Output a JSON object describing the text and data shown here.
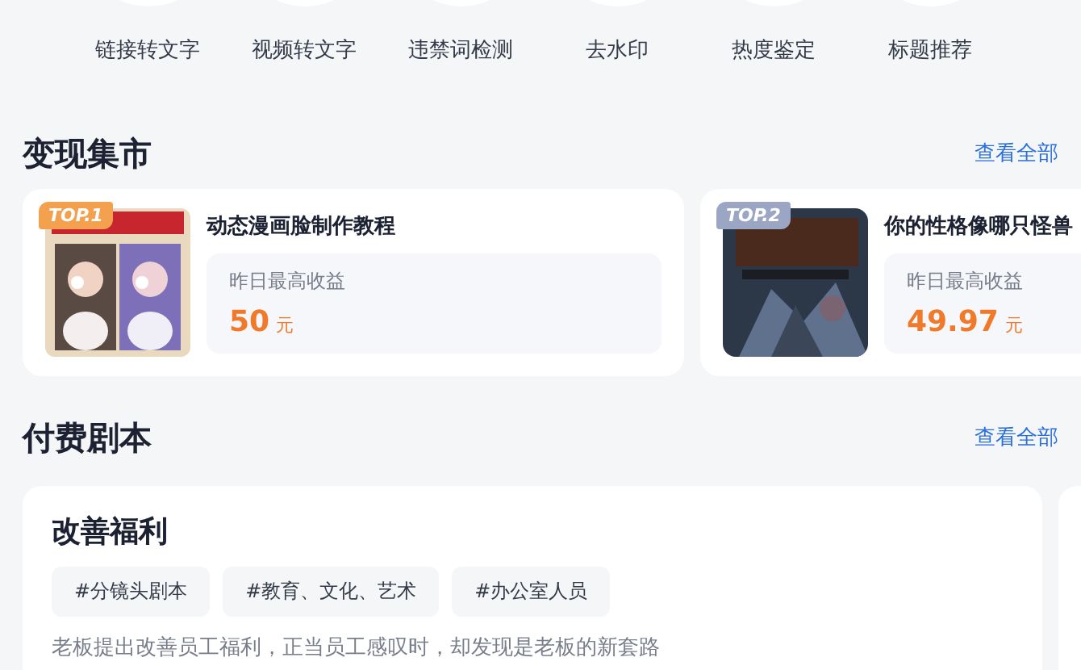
{
  "tools": [
    {
      "label": "链接转文字"
    },
    {
      "label": "视频转文字"
    },
    {
      "label": "违禁词检测"
    },
    {
      "label": "去水印"
    },
    {
      "label": "热度鉴定"
    },
    {
      "label": "标题推荐"
    }
  ],
  "monetize": {
    "title": "变现集市",
    "more": "查看全部",
    "items": [
      {
        "rank": "TOP.1",
        "title": "动态漫画脸制作教程",
        "income_label": "昨日最高收益",
        "amount": "50",
        "unit": "元",
        "kind": "portrait"
      },
      {
        "rank": "TOP.2",
        "title": "你的性格像哪只怪兽",
        "income_label": "昨日最高收益",
        "amount": "49.97",
        "unit": "元",
        "kind": "dark"
      }
    ]
  },
  "scripts": {
    "title": "付费剧本",
    "more": "查看全部",
    "items": [
      {
        "title": "改善福利",
        "tags": [
          "#分镜头剧本",
          "#教育、文化、艺术",
          "#办公室人员"
        ],
        "description": "老板提出改善员工福利，正当员工感叹时，却发现是老板的新套路"
      }
    ]
  }
}
